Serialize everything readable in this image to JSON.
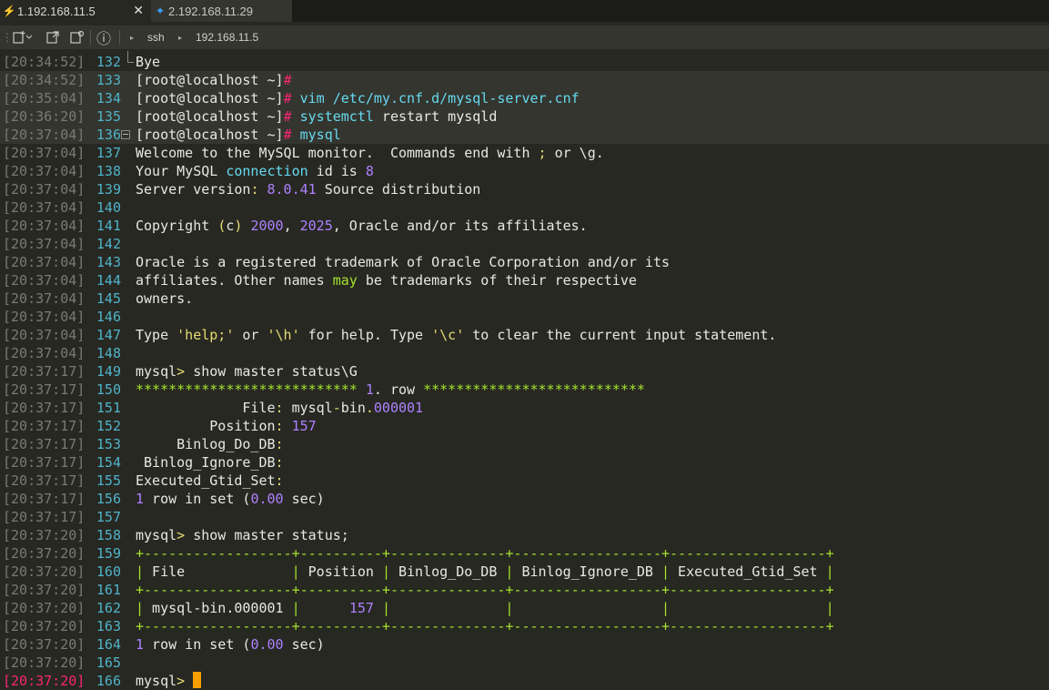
{
  "tabs": [
    {
      "label": "1.192.168.11.5",
      "icon": "lightning-icon",
      "close": "✕"
    },
    {
      "label": "2.192.168.11.29",
      "icon": "pin-icon"
    }
  ],
  "toolbar": {
    "info": "ⓘ",
    "protocol": "ssh",
    "host": "192.168.11.5"
  },
  "colors": {
    "background": "#272822",
    "timestamp": "#7a7a72",
    "line_number": "#4fb3c9",
    "hash": "#f92672",
    "command": "#66d9ef",
    "number": "#ae81ff",
    "string": "#e6db74",
    "separator": "#a6e22e",
    "cursor": "#f5a000"
  },
  "lines": [
    {
      "ts": "[20:34:52]",
      "n": "132",
      "text": "Bye"
    },
    {
      "ts": "[20:34:52]",
      "n": "133",
      "prompt": "[root@localhost ~]",
      "hash": "#"
    },
    {
      "ts": "[20:35:04]",
      "n": "134",
      "prompt": "[root@localhost ~]",
      "hash": "#",
      "cmd": " vim /etc/my.cnf.d/mysql-server.cnf"
    },
    {
      "ts": "[20:36:20]",
      "n": "135",
      "prompt": "[root@localhost ~]",
      "hash": "#",
      "cmd": " systemctl",
      "rest": " restart mysqld"
    },
    {
      "ts": "[20:37:04]",
      "n": "136",
      "prompt": "[root@localhost ~]",
      "hash": "#",
      "cmd": " mysql"
    },
    {
      "ts": "[20:37:04]",
      "n": "137",
      "text": "Welcome to the MySQL monitor.  Commands end with ; or \\g."
    },
    {
      "ts": "[20:37:04]",
      "n": "138",
      "text": "Your MySQL connection id is 8"
    },
    {
      "ts": "[20:37:04]",
      "n": "139",
      "text": "Server version: 8.0.41 Source distribution"
    },
    {
      "ts": "[20:37:04]",
      "n": "140",
      "text": ""
    },
    {
      "ts": "[20:37:04]",
      "n": "141",
      "text": "Copyright (c) 2000, 2025, Oracle and/or its affiliates."
    },
    {
      "ts": "[20:37:04]",
      "n": "142",
      "text": ""
    },
    {
      "ts": "[20:37:04]",
      "n": "143",
      "text": "Oracle is a registered trademark of Oracle Corporation and/or its"
    },
    {
      "ts": "[20:37:04]",
      "n": "144",
      "text": "affiliates. Other names may be trademarks of their respective"
    },
    {
      "ts": "[20:37:04]",
      "n": "145",
      "text": "owners."
    },
    {
      "ts": "[20:37:04]",
      "n": "146",
      "text": ""
    },
    {
      "ts": "[20:37:04]",
      "n": "147",
      "text": "Type 'help;' or '\\h' for help. Type '\\c' to clear the current input statement."
    },
    {
      "ts": "[20:37:04]",
      "n": "148",
      "text": ""
    },
    {
      "ts": "[20:37:17]",
      "n": "149",
      "text": "mysql> show master status\\G"
    },
    {
      "ts": "[20:37:17]",
      "n": "150",
      "text": "*************************** 1. row ***************************"
    },
    {
      "ts": "[20:37:17]",
      "n": "151",
      "text": "             File: mysql-bin.000001"
    },
    {
      "ts": "[20:37:17]",
      "n": "152",
      "text": "         Position: 157"
    },
    {
      "ts": "[20:37:17]",
      "n": "153",
      "text": "     Binlog_Do_DB:"
    },
    {
      "ts": "[20:37:17]",
      "n": "154",
      "text": " Binlog_Ignore_DB:"
    },
    {
      "ts": "[20:37:17]",
      "n": "155",
      "text": "Executed_Gtid_Set:"
    },
    {
      "ts": "[20:37:17]",
      "n": "156",
      "text": "1 row in set (0.00 sec)"
    },
    {
      "ts": "[20:37:17]",
      "n": "157",
      "text": ""
    },
    {
      "ts": "[20:37:20]",
      "n": "158",
      "text": "mysql> show master status;"
    },
    {
      "ts": "[20:37:20]",
      "n": "159",
      "text": "+------------------+----------+--------------+------------------+-------------------+"
    },
    {
      "ts": "[20:37:20]",
      "n": "160",
      "text": "| File             | Position | Binlog_Do_DB | Binlog_Ignore_DB | Executed_Gtid_Set |"
    },
    {
      "ts": "[20:37:20]",
      "n": "161",
      "text": "+------------------+----------+--------------+------------------+-------------------+"
    },
    {
      "ts": "[20:37:20]",
      "n": "162",
      "text": "| mysql-bin.000001 |      157 |              |                  |                   |"
    },
    {
      "ts": "[20:37:20]",
      "n": "163",
      "text": "+------------------+----------+--------------+------------------+-------------------+"
    },
    {
      "ts": "[20:37:20]",
      "n": "164",
      "text": "1 row in set (0.00 sec)"
    },
    {
      "ts": "[20:37:20]",
      "n": "165",
      "text": ""
    },
    {
      "ts": "[20:37:20]",
      "n": "166",
      "text": "mysql> ",
      "cursor": true
    }
  ]
}
